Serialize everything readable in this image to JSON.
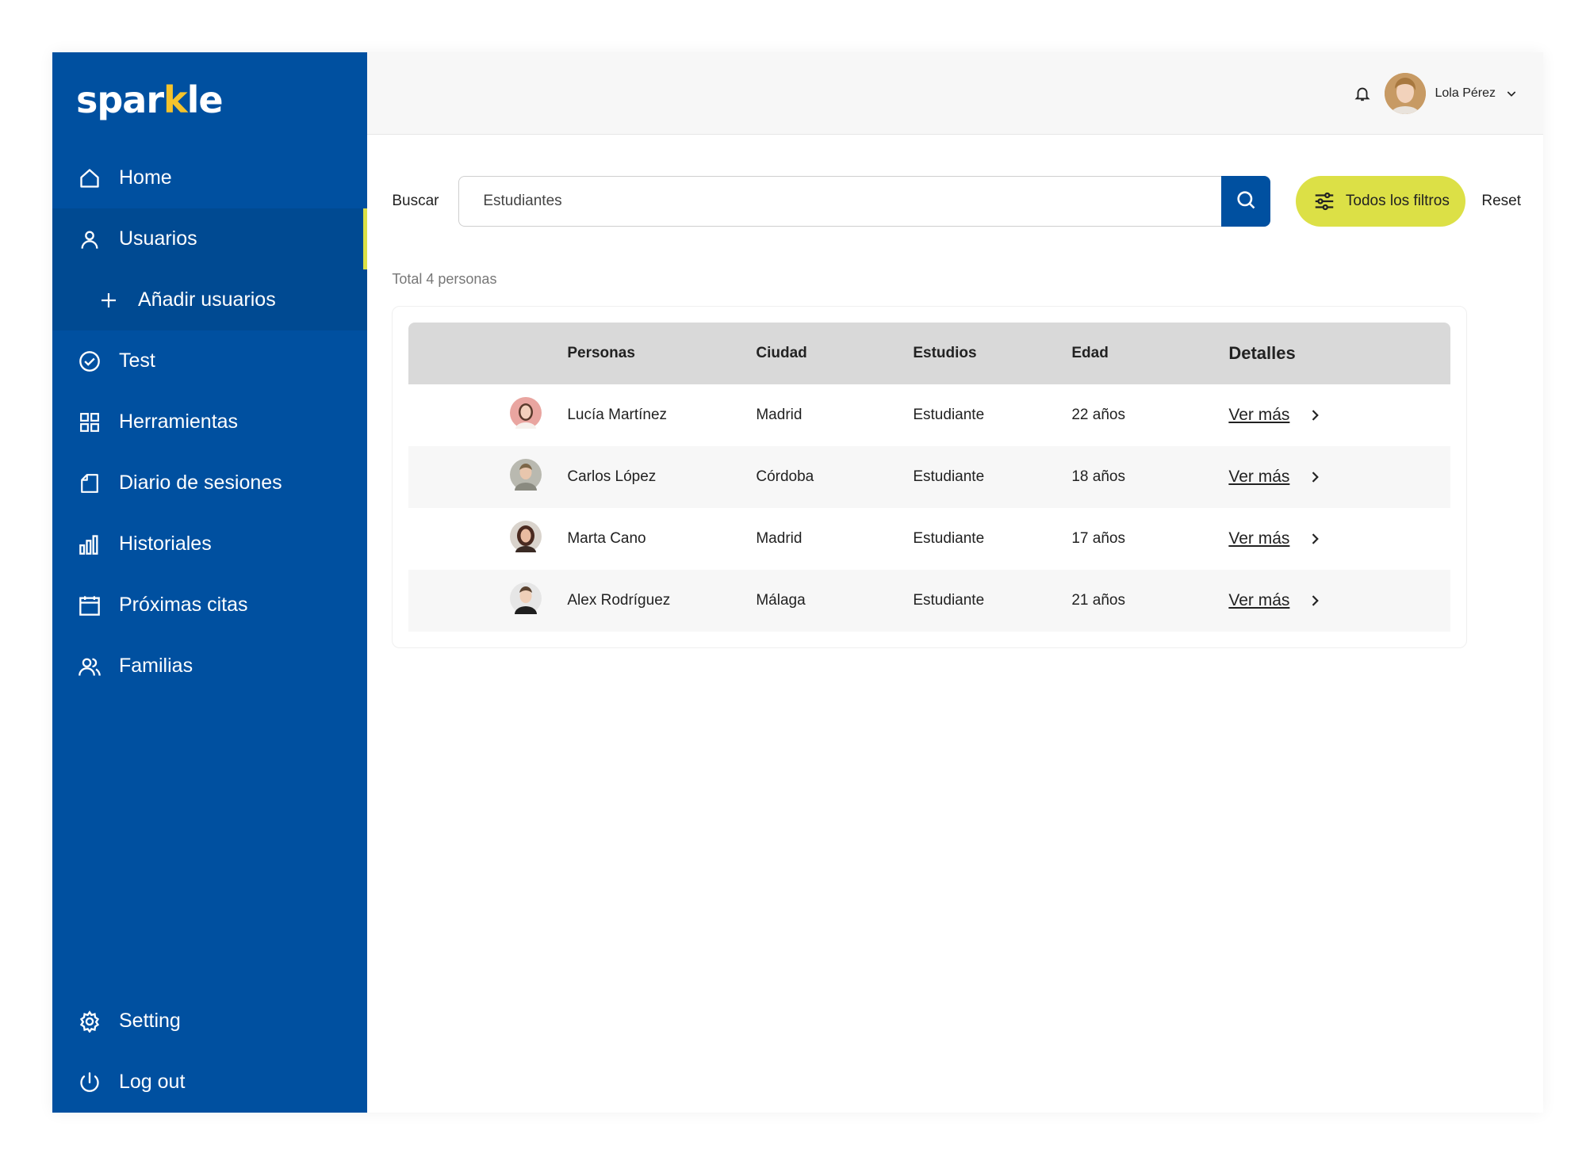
{
  "app": {
    "logo": {
      "part1": "spar",
      "part2": "k",
      "part3": "le"
    }
  },
  "colors": {
    "sidebar": "#0050a0",
    "accent": "#dce046",
    "primary": "#0050a0"
  },
  "sidebar": {
    "items": [
      {
        "label": "Home",
        "icon": "home-icon"
      },
      {
        "label": "Usuarios",
        "icon": "user-icon"
      },
      {
        "label": "Añadir usuarios",
        "icon": "plus-icon"
      },
      {
        "label": "Test",
        "icon": "check-circle-icon"
      },
      {
        "label": "Herramientas",
        "icon": "grid-icon"
      },
      {
        "label": "Diario de sesiones",
        "icon": "document-icon"
      },
      {
        "label": "Historiales",
        "icon": "bar-chart-icon"
      },
      {
        "label": "Próximas citas",
        "icon": "calendar-icon"
      },
      {
        "label": "Familias",
        "icon": "users-icon"
      }
    ],
    "bottom": [
      {
        "label": "Setting",
        "icon": "gear-icon"
      },
      {
        "label": "Log out",
        "icon": "power-icon"
      }
    ]
  },
  "header": {
    "user_name": "Lola Pérez"
  },
  "search": {
    "label": "Buscar",
    "value": "Estudiantes",
    "filters_label": "Todos los filtros",
    "reset_label": "Reset"
  },
  "total_text": "Total 4 personas",
  "table": {
    "columns": [
      "Personas",
      "Ciudad",
      "Estudios",
      "Edad",
      "Detalles"
    ],
    "rows": [
      {
        "name": "Lucía Martínez",
        "city": "Madrid",
        "studies": "Estudiante",
        "age": "22 años",
        "link": "Ver más"
      },
      {
        "name": "Carlos López",
        "city": "Córdoba",
        "studies": "Estudiante",
        "age": "18 años",
        "link": "Ver más"
      },
      {
        "name": "Marta  Cano",
        "city": "Madrid",
        "studies": "Estudiante",
        "age": "17 años",
        "link": "Ver más"
      },
      {
        "name": "Alex Rodríguez",
        "city": "Málaga",
        "studies": "Estudiante",
        "age": "21 años",
        "link": "Ver más"
      }
    ]
  }
}
